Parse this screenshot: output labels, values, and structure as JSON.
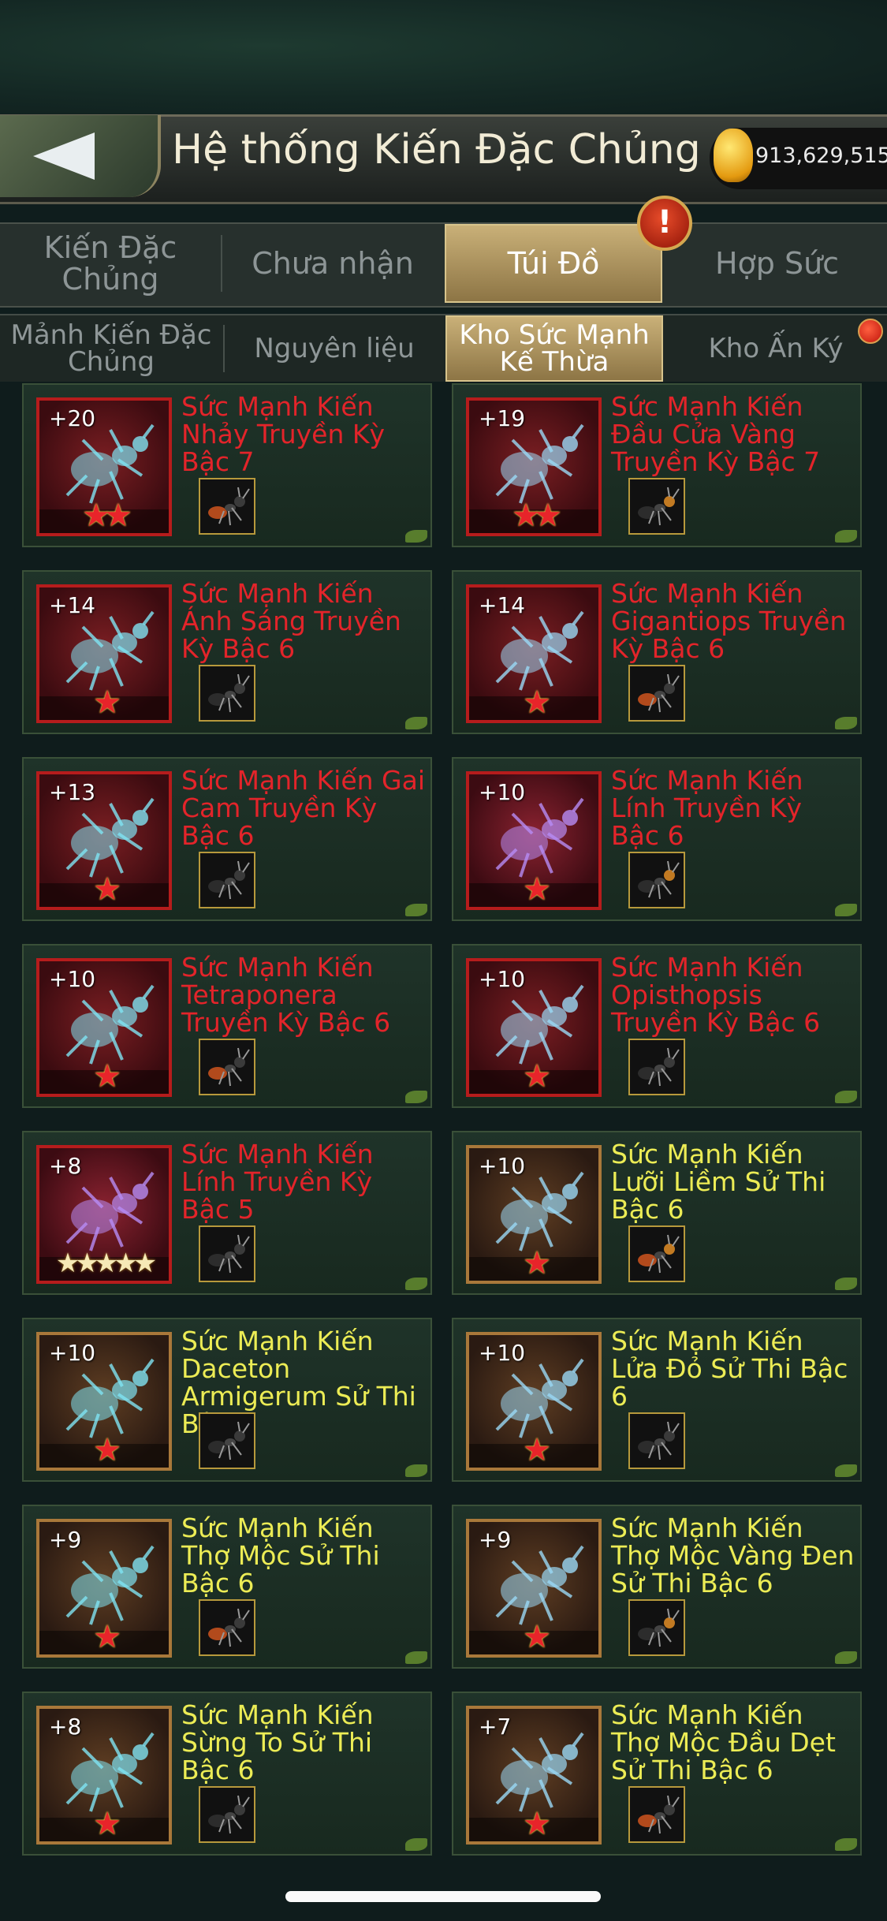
{
  "header": {
    "title": "Hệ thống Kiến Đặc Chủng",
    "currency_value": "913,629,515"
  },
  "main_tabs": [
    {
      "label": "Kiến Đặc Chủng"
    },
    {
      "label": "Chưa nhận"
    },
    {
      "label": "Túi Đồ",
      "active": true
    },
    {
      "label": "Hợp Sức"
    }
  ],
  "alert_badge": "!",
  "sub_tabs": [
    {
      "label": "Mảnh Kiến Đặc Chủng"
    },
    {
      "label": "Nguyên liệu"
    },
    {
      "label": "Kho Sức Mạnh Kế Thừa",
      "active": true
    },
    {
      "label": "Kho Ấn Ký"
    }
  ],
  "items": [
    {
      "level": "+20",
      "name": "Sức Mạnh Kiến Nhảy Truyền Kỳ Bậc 7",
      "stars": "★★",
      "rarity": "red"
    },
    {
      "level": "+19",
      "name": "Sức Mạnh Kiến Đầu Cửa Vàng Truyền Kỳ Bậc 7",
      "stars": "★★",
      "rarity": "red"
    },
    {
      "level": "+14",
      "name": "Sức Mạnh Kiến Ánh Sáng Truyền Kỳ Bậc 6",
      "stars": "★",
      "rarity": "red"
    },
    {
      "level": "+14",
      "name": "Sức Mạnh Kiến Gigantiops Truyền Kỳ Bậc 6",
      "stars": "★",
      "rarity": "red"
    },
    {
      "level": "+13",
      "name": "Sức Mạnh Kiến Gai Cam Truyền Kỳ Bậc 6",
      "stars": "★",
      "rarity": "red"
    },
    {
      "level": "+10",
      "name": "Sức Mạnh Kiến Lính Truyền Kỳ Bậc 6",
      "stars": "★",
      "rarity": "red"
    },
    {
      "level": "+10",
      "name": "Sức Mạnh Kiến Tetraponera Truyền Kỳ Bậc 6",
      "stars": "★",
      "rarity": "red"
    },
    {
      "level": "+10",
      "name": "Sức Mạnh Kiến Opisthopsis Truyền Kỳ Bậc 6",
      "stars": "★",
      "rarity": "red"
    },
    {
      "level": "+8",
      "name": "Sức Mạnh Kiến Lính Truyền Kỳ Bậc 5",
      "stars": "★★★★★",
      "rarity": "red"
    },
    {
      "level": "+10",
      "name": "Sức Mạnh Kiến Lưỡi Liềm Sử Thi Bậc 6",
      "stars": "★",
      "rarity": "gold"
    },
    {
      "level": "+10",
      "name": "Sức Mạnh Kiến Daceton Armigerum Sử Thi Bậc 6",
      "stars": "★",
      "rarity": "gold"
    },
    {
      "level": "+10",
      "name": "Sức Mạnh Kiến Lửa Đỏ Sử Thi Bậc 6",
      "stars": "★",
      "rarity": "gold"
    },
    {
      "level": "+9",
      "name": "Sức Mạnh Kiến Thợ Mộc Sử Thi Bậc 6",
      "stars": "★",
      "rarity": "gold"
    },
    {
      "level": "+9",
      "name": "Sức Mạnh Kiến Thợ Mộc Vàng Đen Sử Thi Bậc 6",
      "stars": "★",
      "rarity": "gold"
    },
    {
      "level": "+8",
      "name": "Sức Mạnh Kiến Sừng To Sử Thi Bậc 6",
      "stars": "★",
      "rarity": "gold"
    },
    {
      "level": "+7",
      "name": "Sức Mạnh Kiến Thợ Mộc Đầu Dẹt Sử Thi Bậc 6",
      "stars": "★",
      "rarity": "gold"
    }
  ],
  "colors": {
    "legendary_text": "#e3242a",
    "epic_text": "#ecec55",
    "active_tab": "#c9b078"
  }
}
